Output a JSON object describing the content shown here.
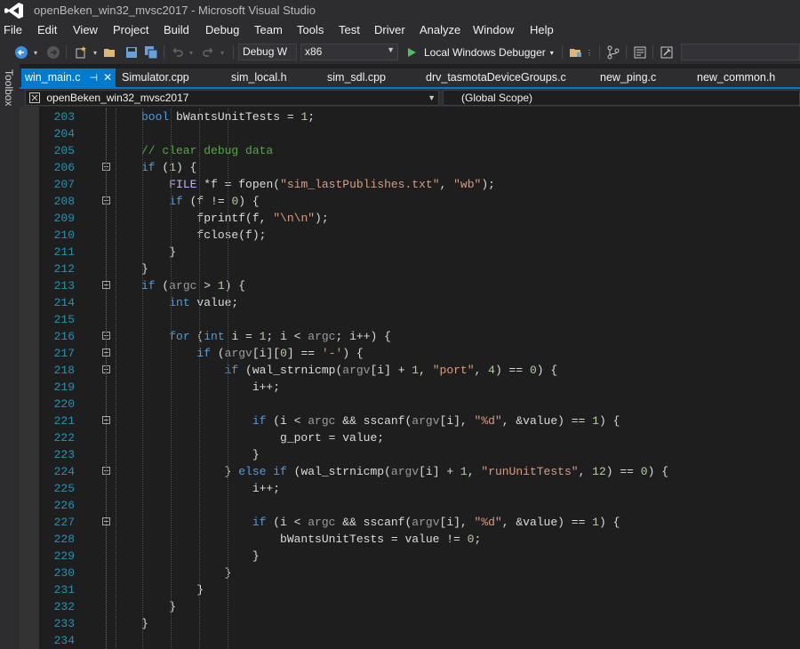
{
  "window": {
    "title": "openBeken_win32_mvsc2017 - Microsoft Visual Studio"
  },
  "menu": [
    "File",
    "Edit",
    "View",
    "Project",
    "Build",
    "Debug",
    "Team",
    "Tools",
    "Test",
    "Driver",
    "Analyze",
    "Window",
    "Help"
  ],
  "toolbar": {
    "config": "Debug W",
    "platform": "x86",
    "run_label": "Local Windows Debugger"
  },
  "toolbox_label": "Toolbox",
  "tabs": [
    "win_main.c",
    "Simulator.cpp",
    "sim_local.h",
    "sim_sdl.cpp",
    "drv_tasmotaDeviceGroups.c",
    "new_ping.c",
    "new_common.h"
  ],
  "nav": {
    "project": "openBeken_win32_mvsc2017",
    "scope": "(Global Scope)"
  },
  "code_lines": [
    {
      "n": "203",
      "text": "bool bWantsUnitTests = 1;"
    },
    {
      "n": "204",
      "text": ""
    },
    {
      "n": "205",
      "text": "// clear debug data"
    },
    {
      "n": "206",
      "text": "if (1) {"
    },
    {
      "n": "207",
      "text": "    FILE *f = fopen(\"sim_lastPublishes.txt\", \"wb\");"
    },
    {
      "n": "208",
      "text": "    if (f != 0) {"
    },
    {
      "n": "209",
      "text": "        fprintf(f, \"\\n\\n\");"
    },
    {
      "n": "210",
      "text": "        fclose(f);"
    },
    {
      "n": "211",
      "text": "    }"
    },
    {
      "n": "212",
      "text": "}"
    },
    {
      "n": "213",
      "text": "if (argc > 1) {"
    },
    {
      "n": "214",
      "text": "    int value;"
    },
    {
      "n": "215",
      "text": ""
    },
    {
      "n": "216",
      "text": "    for (int i = 1; i < argc; i++) {"
    },
    {
      "n": "217",
      "text": "        if (argv[i][0] == '-') {"
    },
    {
      "n": "218",
      "text": "            if (wal_strnicmp(argv[i] + 1, \"port\", 4) == 0) {"
    },
    {
      "n": "219",
      "text": "                i++;"
    },
    {
      "n": "220",
      "text": ""
    },
    {
      "n": "221",
      "text": "                if (i < argc && sscanf(argv[i], \"%d\", &value) == 1) {"
    },
    {
      "n": "222",
      "text": "                    g_port = value;"
    },
    {
      "n": "223",
      "text": "                }"
    },
    {
      "n": "224",
      "text": "            } else if (wal_strnicmp(argv[i] + 1, \"runUnitTests\", 12) == 0) {"
    },
    {
      "n": "225",
      "text": "                i++;"
    },
    {
      "n": "226",
      "text": ""
    },
    {
      "n": "227",
      "text": "                if (i < argc && sscanf(argv[i], \"%d\", &value) == 1) {"
    },
    {
      "n": "228",
      "text": "                    bWantsUnitTests = value != 0;"
    },
    {
      "n": "229",
      "text": "                }"
    },
    {
      "n": "230",
      "text": "            }"
    },
    {
      "n": "231",
      "text": "        }"
    },
    {
      "n": "232",
      "text": "    }"
    },
    {
      "n": "233",
      "text": "}"
    },
    {
      "n": "234",
      "text": ""
    }
  ],
  "fold_lines": [
    "206",
    "208",
    "213",
    "216",
    "217",
    "218",
    "221",
    "224",
    "227"
  ]
}
